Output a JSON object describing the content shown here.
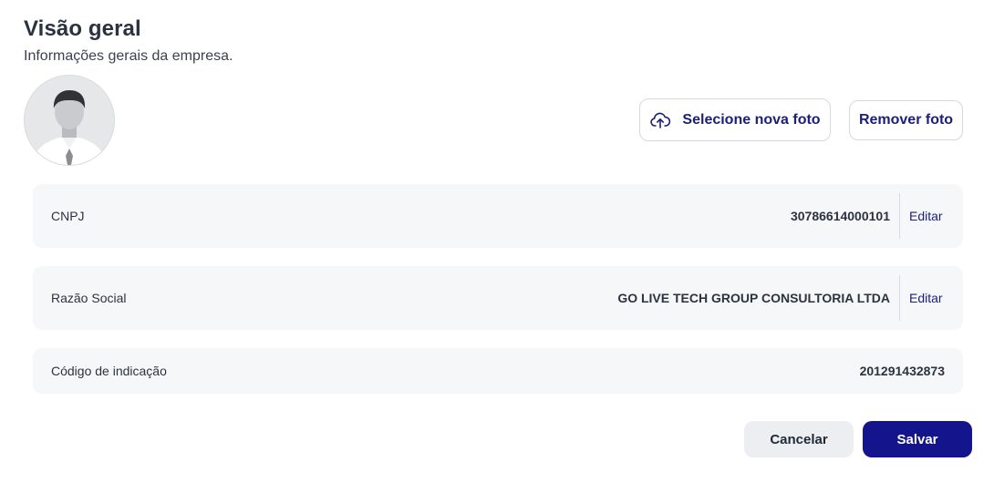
{
  "header": {
    "title": "Visão geral",
    "subtitle": "Informações gerais da empresa."
  },
  "photo": {
    "select_label": "Selecione nova foto",
    "remove_label": "Remover foto"
  },
  "fields": [
    {
      "label": "CNPJ",
      "value": "30786614000101",
      "edit_label": "Editar"
    },
    {
      "label": "Razão Social",
      "value": "GO LIVE TECH GROUP CONSULTORIA LTDA",
      "edit_label": "Editar"
    },
    {
      "label": "Código de indicação",
      "value": "201291432873"
    }
  ],
  "actions": {
    "cancel_label": "Cancelar",
    "save_label": "Salvar"
  },
  "colors": {
    "primary": "#14148c",
    "link": "#1a1f7a",
    "row_background": "#f6f7f9"
  },
  "icons": {
    "upload": "cloud-upload-icon",
    "avatar": "user-placeholder-icon"
  }
}
